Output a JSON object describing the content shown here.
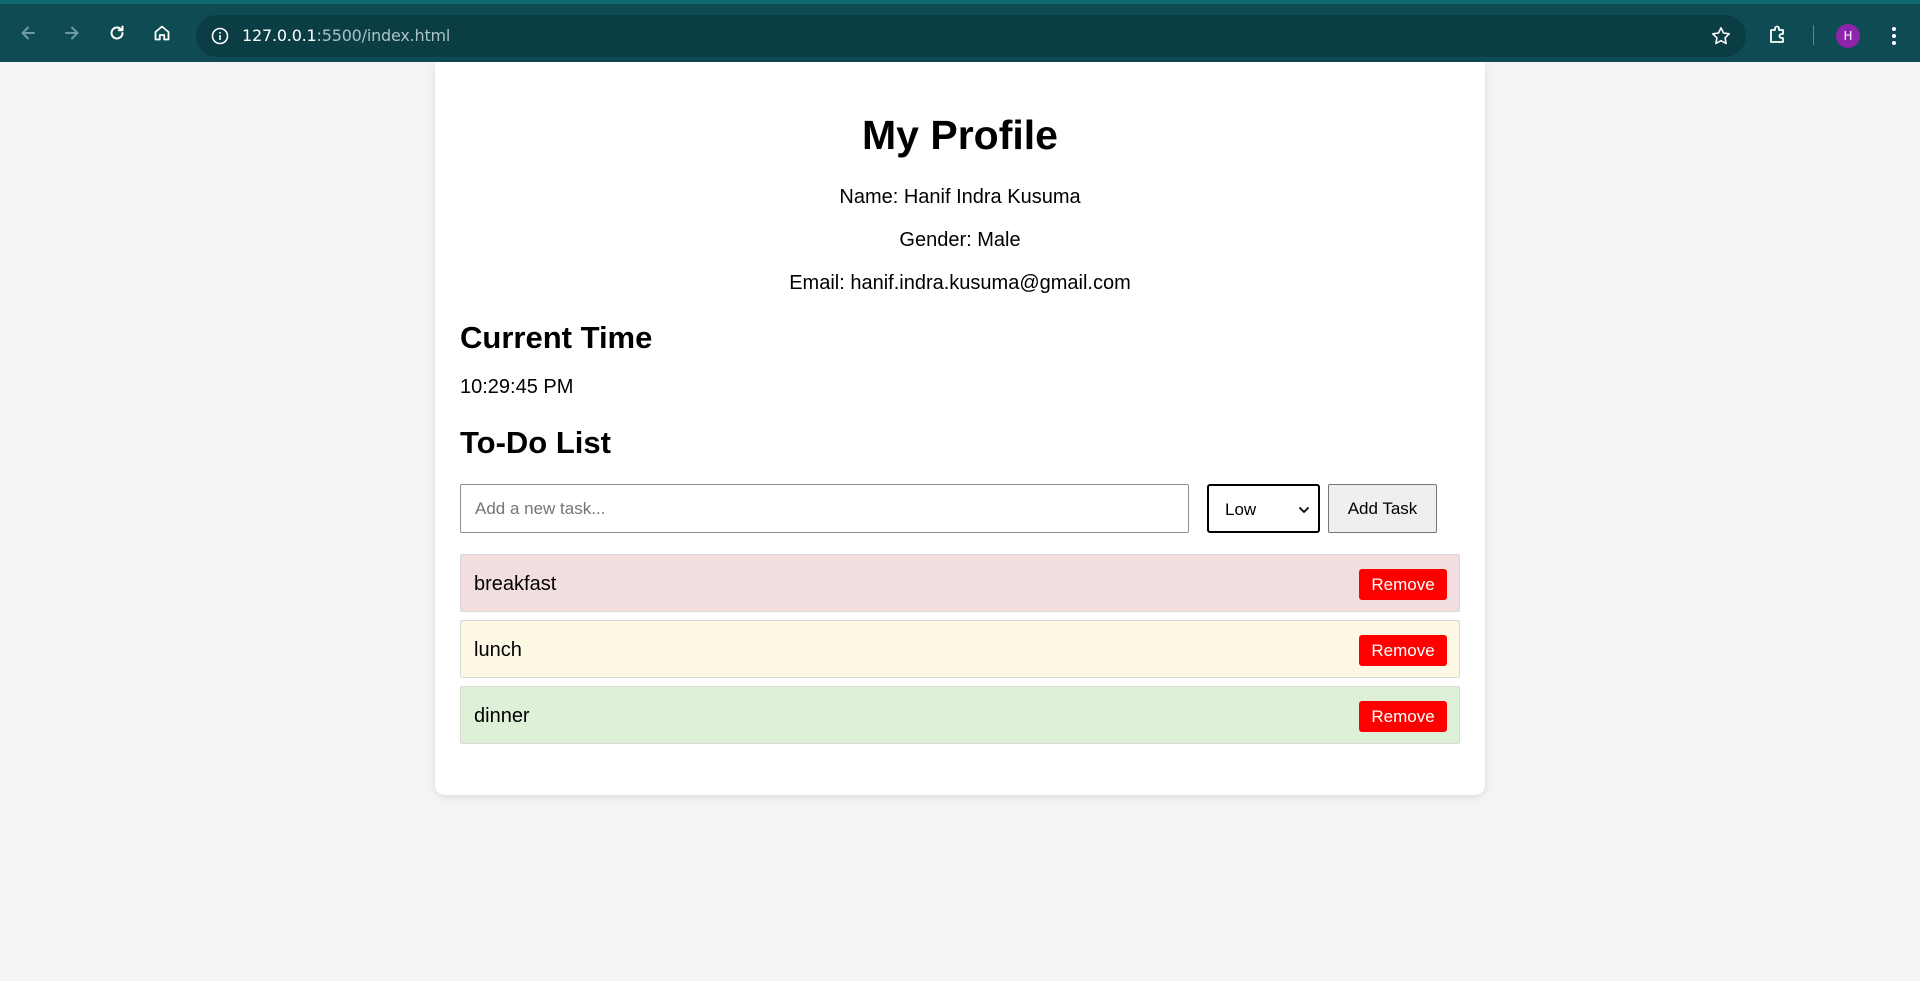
{
  "browser": {
    "url_host": "127.0.0.1",
    "url_rest": ":5500/index.html",
    "profile_initial": "H",
    "colors": {
      "toolbar": "#0f4b53",
      "omnibox": "#0b3d44",
      "avatar": "#8e24aa"
    },
    "icons": [
      "back-icon",
      "forward-icon",
      "reload-icon",
      "home-icon",
      "site-info-icon",
      "bookmark-star-icon",
      "extensions-icon",
      "kebab-menu-icon"
    ]
  },
  "profile": {
    "title": "My Profile",
    "name": "Name: Hanif Indra Kusuma",
    "gender": "Gender: Male",
    "email": "Email: hanif.indra.kusuma@gmail.com"
  },
  "time": {
    "heading": "Current Time",
    "value": "10:29:45 PM"
  },
  "todo": {
    "heading": "To-Do List",
    "input_placeholder": "Add a new task...",
    "priority_selected": "Low",
    "add_label": "Add Task",
    "remove_label": "Remove",
    "items": [
      {
        "text": "breakfast",
        "color": "#f2dede"
      },
      {
        "text": "lunch",
        "color": "#fcf8e3"
      },
      {
        "text": "dinner",
        "color": "#dff0d8"
      }
    ],
    "remove_color": "#ff0000"
  }
}
